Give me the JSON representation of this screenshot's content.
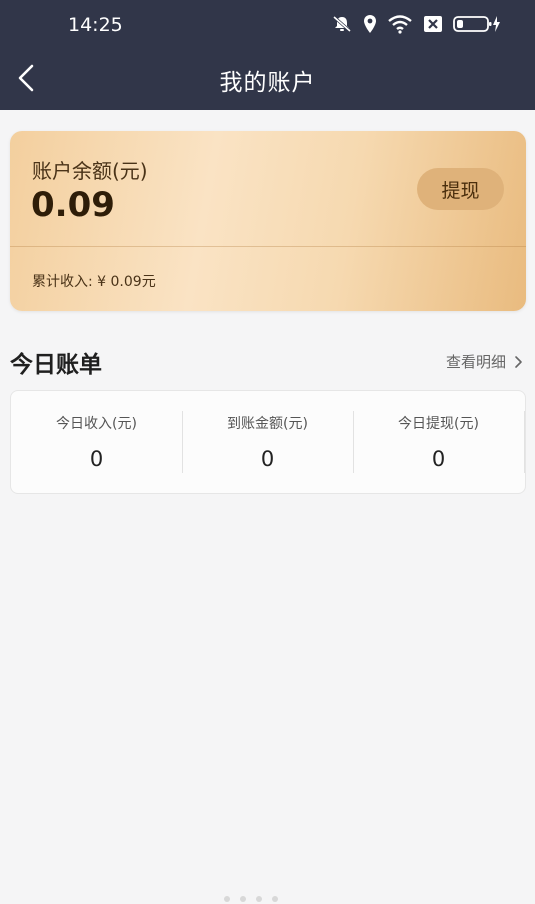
{
  "status_bar": {
    "time": "14:25"
  },
  "nav": {
    "title": "我的账户"
  },
  "balance_card": {
    "label": "账户余额(元)",
    "value": "0.09",
    "withdraw_label": "提现",
    "total_income": "累计收入: ¥ 0.09元"
  },
  "today": {
    "title": "今日账单",
    "detail_link": "查看明细",
    "stats": [
      {
        "label": "今日收入(元)",
        "value": "0"
      },
      {
        "label": "到账金额(元)",
        "value": "0"
      },
      {
        "label": "今日提现(元)",
        "value": "0"
      }
    ]
  },
  "colors": {
    "header_bg": "#313649",
    "card_gold": "#e9bb7f",
    "button_gold": "#dfb27a",
    "page_bg": "#f5f5f6"
  }
}
